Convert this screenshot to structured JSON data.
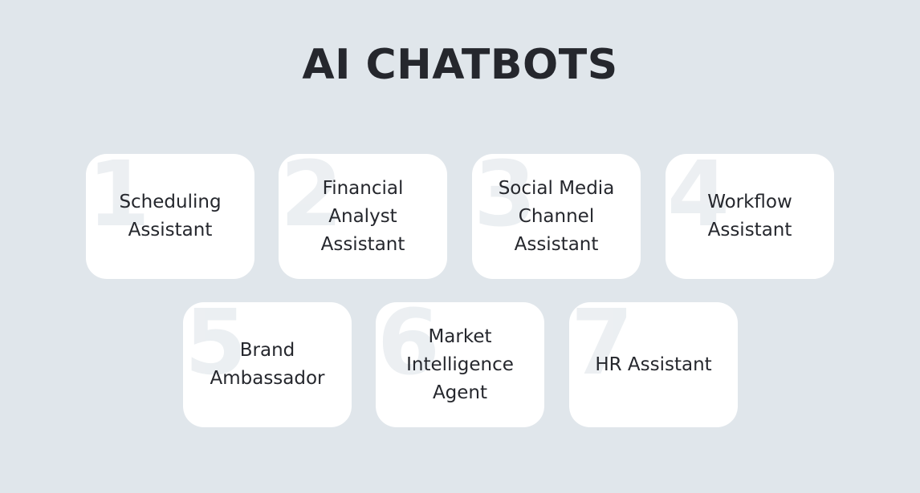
{
  "title": "AI CHATBOTS",
  "colors": {
    "background": "#e0e6eb",
    "card": "#ffffff",
    "text": "#25272d",
    "number_watermark": "#dfe5ea"
  },
  "cards": [
    {
      "number": "1",
      "label": "Scheduling\nAssistant"
    },
    {
      "number": "2",
      "label": "Financial\nAnalyst\nAssistant"
    },
    {
      "number": "3",
      "label": "Social Media\nChannel\nAssistant"
    },
    {
      "number": "4",
      "label": "Workflow\nAssistant"
    },
    {
      "number": "5",
      "label": "Brand\nAmbassador"
    },
    {
      "number": "6",
      "label": "Market\nIntelligence\nAgent"
    },
    {
      "number": "7",
      "label": "HR Assistant"
    }
  ]
}
